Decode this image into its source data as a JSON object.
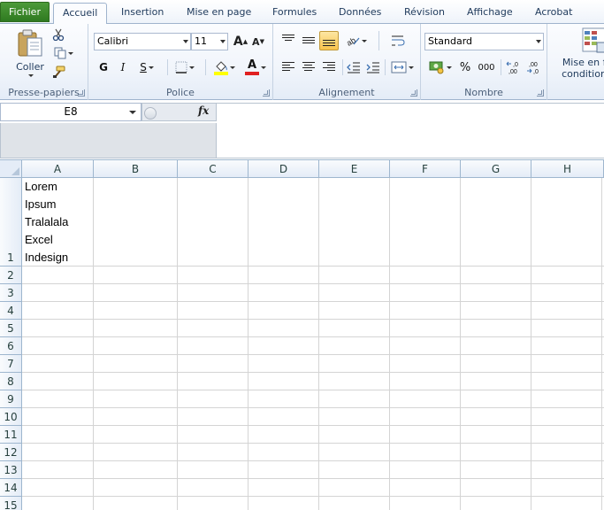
{
  "tabs": [
    "Fichier",
    "Accueil",
    "Insertion",
    "Mise en page",
    "Formules",
    "Données",
    "Révision",
    "Affichage",
    "Acrobat"
  ],
  "active_tab": "Accueil",
  "ribbon": {
    "clipboard": {
      "paste_label": "Coller",
      "group_label": "Presse-papiers"
    },
    "font": {
      "font_name": "Calibri",
      "font_size": "11",
      "bold": "G",
      "italic": "I",
      "underline": "S",
      "grow": "A",
      "shrink": "A",
      "font_color_letter": "A",
      "group_label": "Police"
    },
    "alignment": {
      "group_label": "Alignement"
    },
    "number": {
      "format": "Standard",
      "percent": "%",
      "thousands": "000",
      "inc_decimal": "←,0\n,00",
      "dec_decimal": ",00\n→,0",
      "group_label": "Nombre"
    },
    "styles": {
      "conditional_label_1": "Mise en fo",
      "conditional_label_2": "conditionn"
    }
  },
  "formula_bar": {
    "name_box": "E8",
    "fx": "fx",
    "content": ""
  },
  "columns": [
    "A",
    "B",
    "C",
    "D",
    "E",
    "F",
    "G",
    "H"
  ],
  "rows": [
    "1",
    "2",
    "3",
    "4",
    "5",
    "6",
    "7",
    "8",
    "9",
    "10",
    "11",
    "12",
    "13",
    "14",
    "15"
  ],
  "cell_a1_lines": [
    "Lorem",
    "Ipsum",
    "Tralalala",
    "Excel",
    "Indesign"
  ],
  "colors": {
    "file_tab": "#3f8a2f",
    "header_bg": "#e4ecf7",
    "gridline": "#d4d4d4",
    "accent": "#1e395b"
  }
}
